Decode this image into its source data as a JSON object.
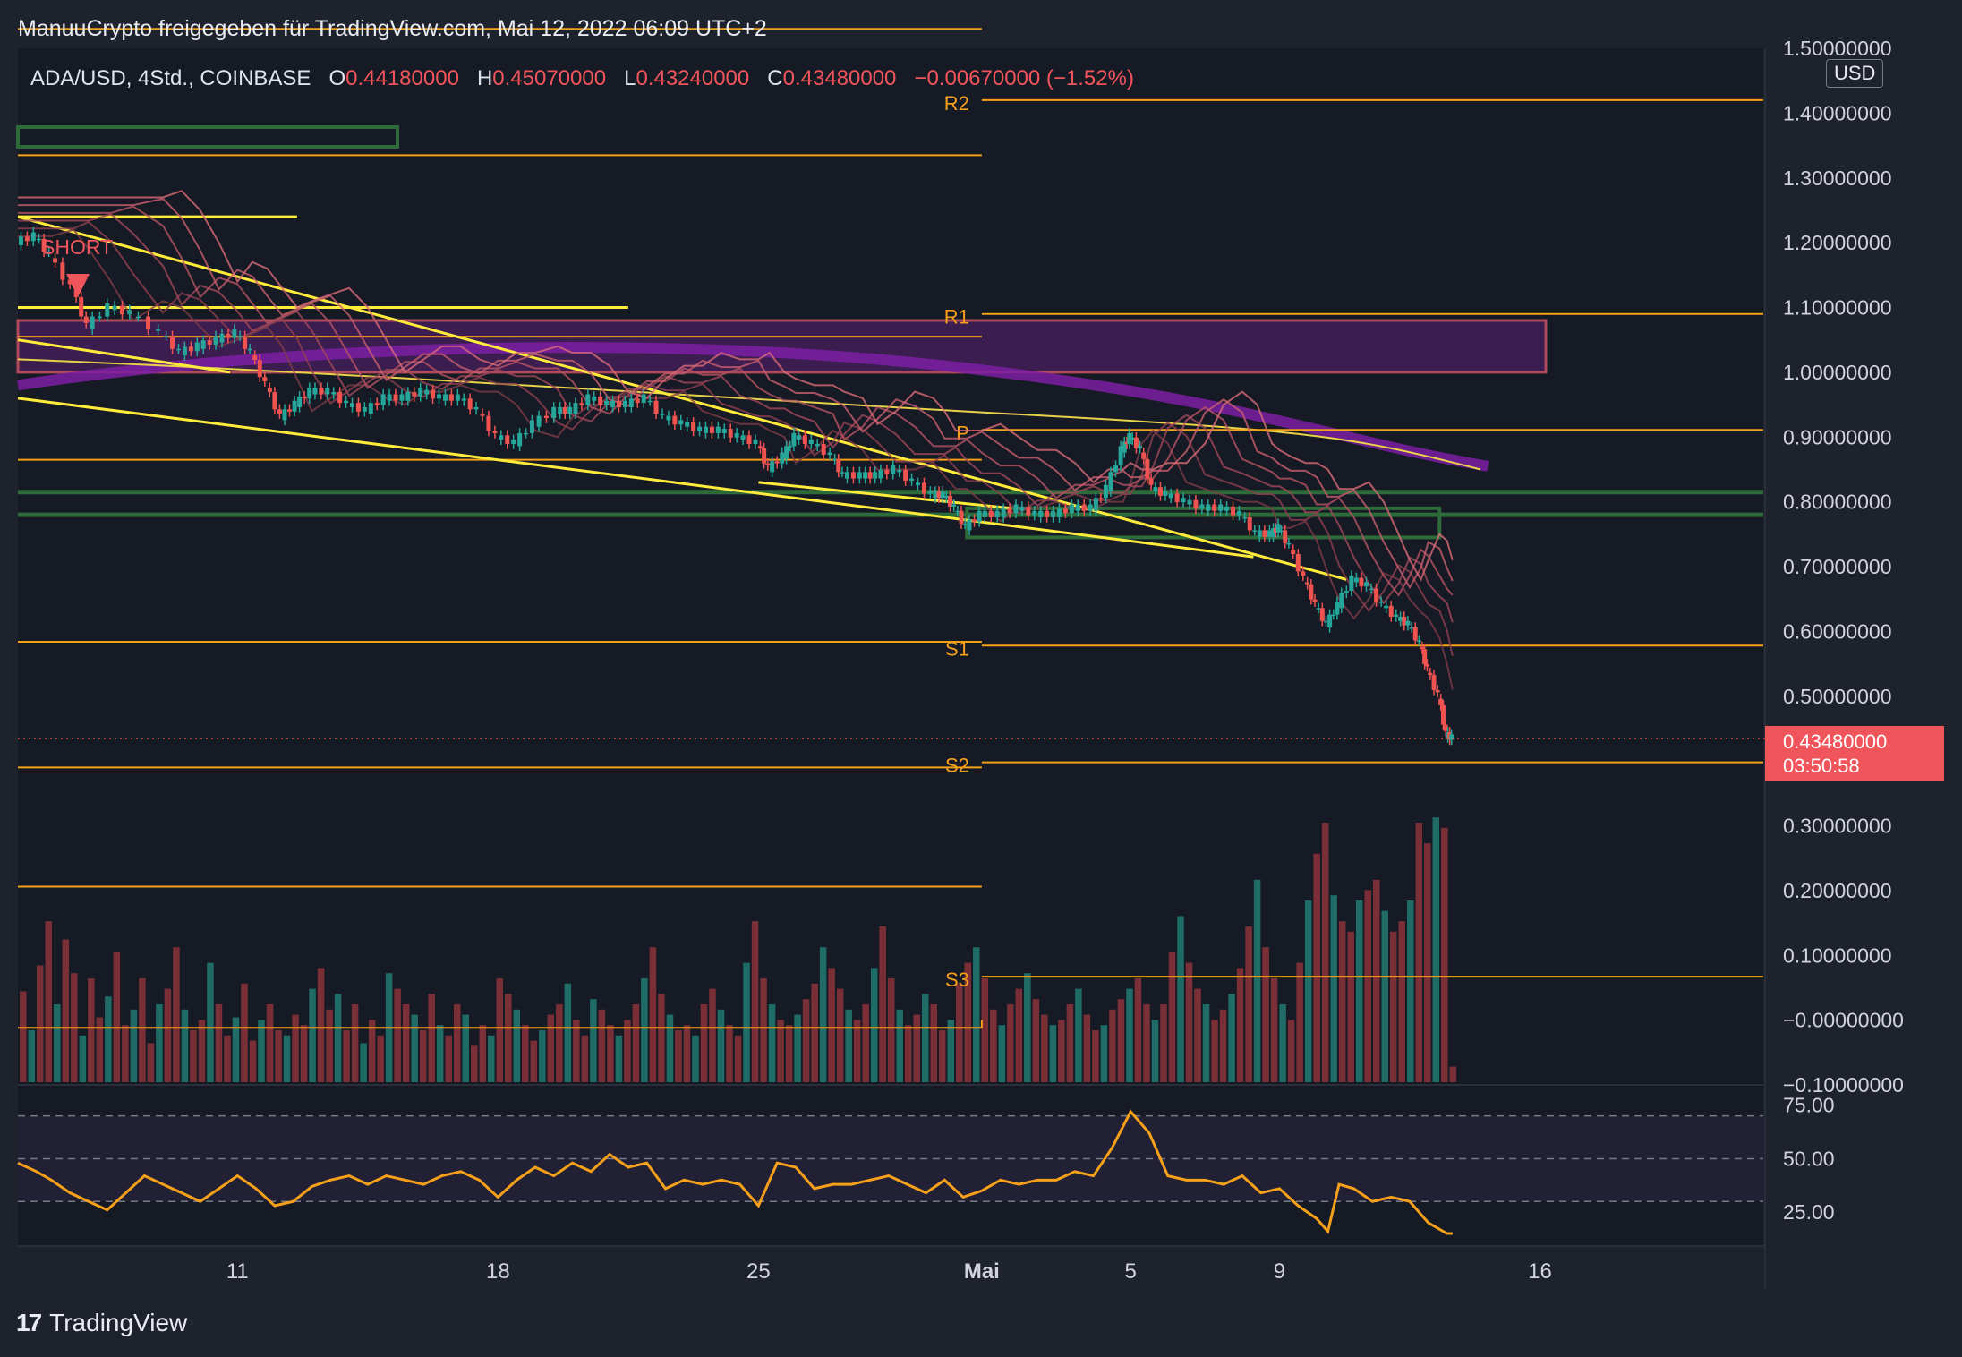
{
  "header": {
    "text": "ManuuCrypto freigegeben für TradingView.com, Mai 12, 2022 06:09 UTC+2"
  },
  "legend": {
    "symbol": "ADA/USD, 4Std., COINBASE",
    "o_label": "O",
    "o_value": "0.44180000",
    "h_label": "H",
    "h_value": "0.45070000",
    "l_label": "L",
    "l_value": "0.43240000",
    "c_label": "C",
    "c_value": "0.43480000",
    "change": "−0.00670000 (−1.52%)"
  },
  "currency_button": "USD",
  "last_price": {
    "value": "0.43480000",
    "countdown": "03:50:58"
  },
  "brand": {
    "logo": "17",
    "name": "TradingView"
  },
  "colors": {
    "background": "#1e222d",
    "up": "#26a69a",
    "down": "#ef5350",
    "pivot": "#f7a01a",
    "trendline": "#ffeb3b",
    "rsi": "#f7a01a",
    "purple_zone": "#6a1b9a"
  },
  "chart_data": {
    "type": "candlestick",
    "symbol": "ADA/USD",
    "timeframe": "4Std.",
    "exchange": "COINBASE",
    "y_ticks": [
      "1.50000000",
      "1.40000000",
      "1.30000000",
      "1.20000000",
      "1.10000000",
      "1.00000000",
      "0.90000000",
      "0.80000000",
      "0.70000000",
      "0.60000000",
      "0.50000000",
      "0.30000000",
      "0.20000000",
      "0.10000000",
      "−0.00000000",
      "−0.10000000"
    ],
    "y_tick_values": [
      1.5,
      1.4,
      1.3,
      1.2,
      1.1,
      1.0,
      0.9,
      0.8,
      0.7,
      0.6,
      0.5,
      0.3,
      0.2,
      0.1,
      0.0,
      -0.1
    ],
    "ylim": [
      -0.1,
      1.5
    ],
    "x_ticks": [
      "11",
      "18",
      "25",
      "Mai",
      "5",
      "9",
      "16"
    ],
    "x_tick_values": [
      11,
      18,
      25,
      31,
      35,
      39,
      46
    ],
    "xlim": [
      5.1,
      52.0
    ],
    "pivot_levels": [
      {
        "label": "R2",
        "value": 1.42
      },
      {
        "label": "R1",
        "value": 1.09
      },
      {
        "label": "P",
        "value": 0.911
      },
      {
        "label": "S1",
        "value": 0.578
      },
      {
        "label": "S2",
        "value": 0.398
      },
      {
        "label": "S3",
        "value": 0.067
      }
    ],
    "previous_pivots": [
      1.53,
      1.335,
      1.055,
      0.865,
      0.584,
      0.39,
      0.206,
      -0.012
    ],
    "annotation": "SHORT",
    "close_path": [
      [
        5.1,
        1.2
      ],
      [
        5.6,
        1.21
      ],
      [
        6.0,
        1.18
      ],
      [
        6.6,
        1.13
      ],
      [
        7.0,
        1.07
      ],
      [
        7.6,
        1.1
      ],
      [
        8.2,
        1.09
      ],
      [
        9.0,
        1.06
      ],
      [
        9.5,
        1.03
      ],
      [
        10.0,
        1.04
      ],
      [
        10.5,
        1.05
      ],
      [
        11.0,
        1.06
      ],
      [
        11.4,
        1.03
      ],
      [
        11.8,
        0.98
      ],
      [
        12.2,
        0.93
      ],
      [
        12.6,
        0.95
      ],
      [
        13.0,
        0.97
      ],
      [
        13.5,
        0.97
      ],
      [
        14.0,
        0.95
      ],
      [
        14.5,
        0.94
      ],
      [
        15.0,
        0.96
      ],
      [
        15.5,
        0.96
      ],
      [
        16.0,
        0.97
      ],
      [
        16.5,
        0.96
      ],
      [
        17.0,
        0.96
      ],
      [
        17.5,
        0.94
      ],
      [
        18.0,
        0.9
      ],
      [
        18.5,
        0.89
      ],
      [
        19.0,
        0.92
      ],
      [
        19.6,
        0.94
      ],
      [
        20.0,
        0.94
      ],
      [
        20.5,
        0.96
      ],
      [
        21.0,
        0.95
      ],
      [
        21.5,
        0.95
      ],
      [
        22.0,
        0.96
      ],
      [
        22.5,
        0.93
      ],
      [
        23.0,
        0.92
      ],
      [
        23.5,
        0.91
      ],
      [
        24.0,
        0.91
      ],
      [
        24.5,
        0.9
      ],
      [
        25.0,
        0.89
      ],
      [
        25.3,
        0.85
      ],
      [
        25.7,
        0.87
      ],
      [
        26.0,
        0.9
      ],
      [
        26.5,
        0.89
      ],
      [
        27.0,
        0.87
      ],
      [
        27.3,
        0.84
      ],
      [
        27.8,
        0.84
      ],
      [
        28.2,
        0.84
      ],
      [
        28.7,
        0.85
      ],
      [
        29.2,
        0.83
      ],
      [
        29.7,
        0.81
      ],
      [
        30.0,
        0.81
      ],
      [
        30.3,
        0.79
      ],
      [
        30.6,
        0.76
      ],
      [
        31.0,
        0.78
      ],
      [
        31.5,
        0.78
      ],
      [
        32.0,
        0.79
      ],
      [
        32.5,
        0.78
      ],
      [
        33.0,
        0.78
      ],
      [
        33.5,
        0.79
      ],
      [
        34.0,
        0.79
      ],
      [
        34.4,
        0.82
      ],
      [
        34.8,
        0.88
      ],
      [
        35.0,
        0.9
      ],
      [
        35.3,
        0.88
      ],
      [
        35.6,
        0.82
      ],
      [
        36.0,
        0.81
      ],
      [
        36.5,
        0.8
      ],
      [
        37.0,
        0.79
      ],
      [
        37.5,
        0.79
      ],
      [
        38.0,
        0.78
      ],
      [
        38.4,
        0.75
      ],
      [
        38.8,
        0.75
      ],
      [
        39.0,
        0.76
      ],
      [
        39.3,
        0.73
      ],
      [
        39.7,
        0.68
      ],
      [
        40.0,
        0.64
      ],
      [
        40.3,
        0.61
      ],
      [
        40.6,
        0.64
      ],
      [
        41.0,
        0.68
      ],
      [
        41.4,
        0.67
      ],
      [
        41.8,
        0.64
      ],
      [
        42.2,
        0.62
      ],
      [
        42.5,
        0.61
      ],
      [
        42.8,
        0.58
      ],
      [
        43.0,
        0.54
      ],
      [
        43.3,
        0.5
      ],
      [
        43.5,
        0.44
      ],
      [
        43.65,
        0.435
      ]
    ],
    "rsi": {
      "levels": [
        70,
        50,
        30
      ],
      "ticks": [
        "75.00",
        "50.00",
        "25.00"
      ],
      "tick_values": [
        75,
        50,
        25
      ],
      "ylim": [
        10,
        82
      ],
      "path": [
        [
          5.1,
          48
        ],
        [
          5.6,
          44
        ],
        [
          6.0,
          40
        ],
        [
          6.5,
          34
        ],
        [
          7.0,
          30
        ],
        [
          7.5,
          26
        ],
        [
          8.0,
          34
        ],
        [
          8.5,
          42
        ],
        [
          9.0,
          38
        ],
        [
          9.5,
          34
        ],
        [
          10.0,
          30
        ],
        [
          10.5,
          36
        ],
        [
          11.0,
          42
        ],
        [
          11.5,
          36
        ],
        [
          12.0,
          28
        ],
        [
          12.5,
          30
        ],
        [
          13.0,
          37
        ],
        [
          13.5,
          40
        ],
        [
          14.0,
          42
        ],
        [
          14.5,
          38
        ],
        [
          15.0,
          42
        ],
        [
          15.5,
          40
        ],
        [
          16.0,
          38
        ],
        [
          16.5,
          42
        ],
        [
          17.0,
          44
        ],
        [
          17.5,
          40
        ],
        [
          18.0,
          32
        ],
        [
          18.5,
          40
        ],
        [
          19.0,
          46
        ],
        [
          19.5,
          42
        ],
        [
          20.0,
          48
        ],
        [
          20.5,
          44
        ],
        [
          21.0,
          52
        ],
        [
          21.5,
          46
        ],
        [
          22.0,
          48
        ],
        [
          22.5,
          36
        ],
        [
          23.0,
          40
        ],
        [
          23.5,
          38
        ],
        [
          24.0,
          40
        ],
        [
          24.5,
          38
        ],
        [
          25.0,
          28
        ],
        [
          25.5,
          48
        ],
        [
          26.0,
          46
        ],
        [
          26.5,
          36
        ],
        [
          27.0,
          38
        ],
        [
          27.5,
          38
        ],
        [
          28.0,
          40
        ],
        [
          28.5,
          42
        ],
        [
          29.0,
          38
        ],
        [
          29.5,
          34
        ],
        [
          30.0,
          40
        ],
        [
          30.5,
          32
        ],
        [
          31.0,
          35
        ],
        [
          31.5,
          40
        ],
        [
          32.0,
          38
        ],
        [
          32.5,
          40
        ],
        [
          33.0,
          40
        ],
        [
          33.5,
          44
        ],
        [
          34.0,
          42
        ],
        [
          34.5,
          55
        ],
        [
          35.0,
          72
        ],
        [
          35.5,
          62
        ],
        [
          36.0,
          42
        ],
        [
          36.5,
          40
        ],
        [
          37.0,
          40
        ],
        [
          37.5,
          38
        ],
        [
          38.0,
          42
        ],
        [
          38.5,
          34
        ],
        [
          39.0,
          36
        ],
        [
          39.5,
          28
        ],
        [
          40.0,
          22
        ],
        [
          40.3,
          16
        ],
        [
          40.6,
          38
        ],
        [
          41.0,
          36
        ],
        [
          41.5,
          30
        ],
        [
          42.0,
          32
        ],
        [
          42.5,
          30
        ],
        [
          43.0,
          20
        ],
        [
          43.5,
          15
        ],
        [
          43.65,
          15
        ]
      ]
    },
    "volume": {
      "ylim": [
        0,
        1
      ],
      "values": [
        0.35,
        0.2,
        0.45,
        0.62,
        0.3,
        0.55,
        0.42,
        0.18,
        0.4,
        0.25,
        0.33,
        0.5,
        0.22,
        0.28,
        0.4,
        0.15,
        0.3,
        0.36,
        0.52,
        0.28,
        0.2,
        0.24,
        0.46,
        0.3,
        0.18,
        0.25,
        0.38,
        0.16,
        0.24,
        0.3,
        0.2,
        0.18,
        0.26,
        0.22,
        0.36,
        0.44,
        0.28,
        0.34,
        0.2,
        0.3,
        0.15,
        0.24,
        0.18,
        0.42,
        0.36,
        0.3,
        0.26,
        0.2,
        0.34,
        0.22,
        0.18,
        0.3,
        0.26,
        0.14,
        0.22,
        0.18,
        0.4,
        0.34,
        0.28,
        0.22,
        0.16,
        0.2,
        0.26,
        0.3,
        0.38,
        0.24,
        0.18,
        0.32,
        0.28,
        0.22,
        0.18,
        0.24,
        0.3,
        0.4,
        0.52,
        0.34,
        0.26,
        0.2,
        0.22,
        0.18,
        0.3,
        0.36,
        0.28,
        0.22,
        0.18,
        0.46,
        0.62,
        0.4,
        0.3,
        0.24,
        0.22,
        0.26,
        0.32,
        0.38,
        0.52,
        0.44,
        0.36,
        0.28,
        0.24,
        0.3,
        0.44,
        0.6,
        0.4,
        0.28,
        0.22,
        0.26,
        0.34,
        0.3,
        0.2,
        0.24,
        0.38,
        0.46,
        0.52,
        0.4,
        0.28,
        0.22,
        0.3,
        0.36,
        0.42,
        0.32,
        0.26,
        0.22,
        0.24,
        0.3,
        0.36,
        0.26,
        0.2,
        0.22,
        0.28,
        0.32,
        0.36,
        0.4,
        0.3,
        0.24,
        0.3,
        0.5,
        0.64,
        0.46,
        0.36,
        0.3,
        0.24,
        0.28,
        0.34,
        0.44,
        0.6,
        0.78,
        0.52,
        0.4,
        0.3,
        0.24,
        0.46,
        0.7,
        0.88,
        1.0,
        0.72,
        0.62,
        0.58,
        0.7,
        0.74,
        0.78,
        0.66,
        0.58,
        0.62,
        0.7,
        1.0,
        0.92,
        1.02,
        0.98,
        0.06
      ]
    }
  }
}
